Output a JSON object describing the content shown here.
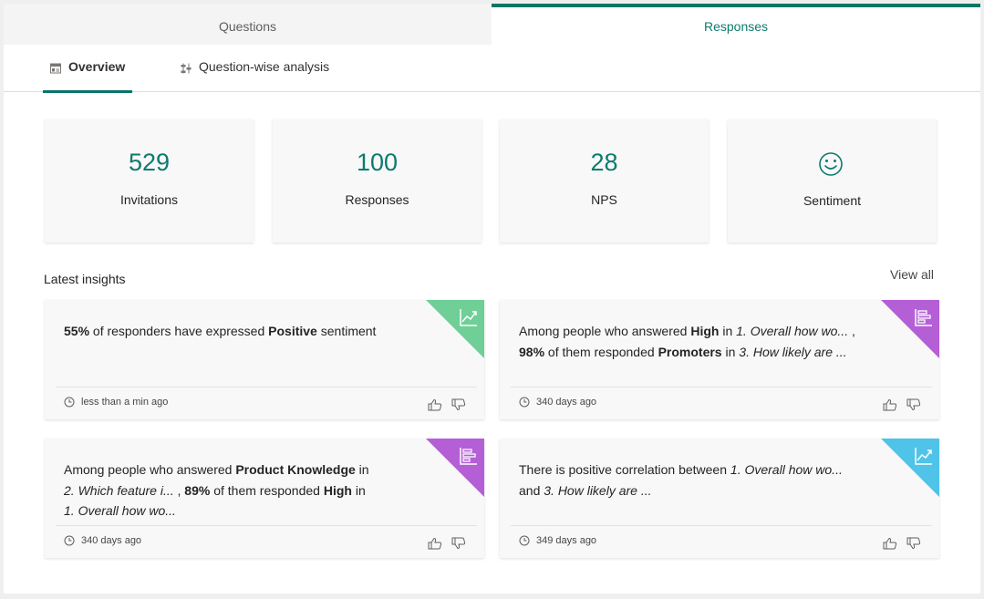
{
  "tabs": {
    "questions": "Questions",
    "responses": "Responses"
  },
  "subtabs": {
    "overview": "Overview",
    "question_wise": "Question-wise analysis"
  },
  "metrics": [
    {
      "value": "529",
      "label": "Invitations"
    },
    {
      "value": "100",
      "label": "Responses"
    },
    {
      "value": "28",
      "label": "NPS"
    },
    {
      "icon": "smiley-icon",
      "label": "Sentiment"
    }
  ],
  "insights_section": {
    "title": "Latest insights",
    "view_all": "View all"
  },
  "insights": [
    {
      "segments": [
        {
          "t": "55%",
          "s": "b"
        },
        {
          "t": " of responders have expressed "
        },
        {
          "t": "Positive",
          "s": "b"
        },
        {
          "t": " sentiment"
        }
      ],
      "time": "less than a min ago",
      "corner_icon": "trend-chart-icon",
      "corner_color": "#6fcf97"
    },
    {
      "segments": [
        {
          "t": "Among people who answered "
        },
        {
          "t": "High",
          "s": "b"
        },
        {
          "t": " in "
        },
        {
          "t": "1. Overall how wo...",
          "s": "i"
        },
        {
          "t": " ,\n"
        },
        {
          "t": "98%",
          "s": "b"
        },
        {
          "t": " of them responded "
        },
        {
          "t": "Promoters",
          "s": "b"
        },
        {
          "t": " in "
        },
        {
          "t": "3. How likely are ...",
          "s": "i"
        }
      ],
      "time": "340 days ago",
      "corner_icon": "bar-chart-icon",
      "corner_color": "#b45fd6"
    },
    {
      "segments": [
        {
          "t": "Among people who answered "
        },
        {
          "t": "Product Knowledge",
          "s": "b"
        },
        {
          "t": " in\n"
        },
        {
          "t": "2. Which feature i...",
          "s": "i"
        },
        {
          "t": " , "
        },
        {
          "t": "89%",
          "s": "b"
        },
        {
          "t": " of them responded "
        },
        {
          "t": "High",
          "s": "b"
        },
        {
          "t": " in\n"
        },
        {
          "t": "1. Overall how wo...",
          "s": "i"
        }
      ],
      "time": "340 days ago",
      "corner_icon": "bar-chart-icon",
      "corner_color": "#b45fd6"
    },
    {
      "segments": [
        {
          "t": "There is positive correlation between "
        },
        {
          "t": "1. Overall how wo...",
          "s": "i"
        },
        {
          "t": "\nand "
        },
        {
          "t": "3. How likely are ...",
          "s": "i"
        }
      ],
      "time": "349 days ago",
      "corner_icon": "trend-chart-icon",
      "corner_color": "#4fc3e8"
    }
  ]
}
